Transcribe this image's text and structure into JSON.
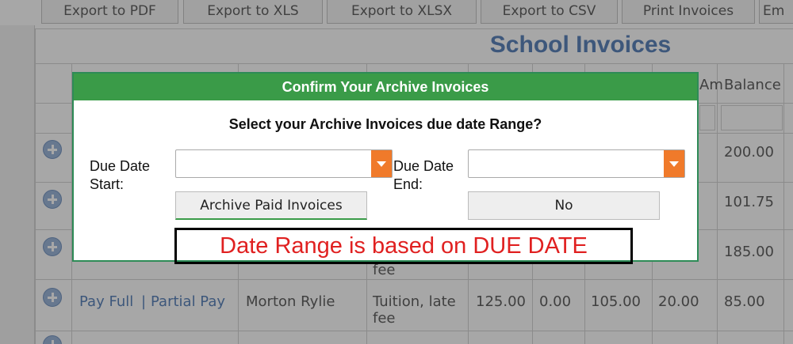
{
  "export_bar": {
    "buttons": [
      "Export to PDF",
      "Export to XLS",
      "Export to XLSX",
      "Export to CSV",
      "Print Invoices",
      "Em"
    ]
  },
  "grid": {
    "title": "School Invoices",
    "headers": {
      "amount_partial": "Am",
      "balance": "Balance"
    },
    "balances_visible": [
      "200.00",
      "101.75",
      "185.00"
    ],
    "row_partial_fee": "fee",
    "last_row": {
      "action_full": "Pay Full",
      "separator": "|",
      "action_partial": "Partial Pay",
      "student": "Morton Rylie",
      "description": "Tuition, late fee",
      "col1": "125.00",
      "col2": "0.00",
      "col3": "105.00",
      "col4": "20.00",
      "balance": "85.00"
    }
  },
  "dialog": {
    "title": "Confirm Your Archive Invoices",
    "question": "Select your Archive Invoices due date Range?",
    "start_label": "Due Date Start:",
    "end_label": "Due Date End:",
    "start_value": "",
    "end_value": "",
    "archive_button": "Archive Paid Invoices",
    "no_button": "No",
    "note": "Date Range is based on DUE DATE"
  },
  "colors": {
    "dialog_header": "#3a9b48",
    "dropdown_arrow": "#f07a2a",
    "note_text": "#e02020",
    "grid_title": "#3e6eaf"
  },
  "icons": [
    "plus-circle-icon",
    "chevron-down-icon"
  ]
}
